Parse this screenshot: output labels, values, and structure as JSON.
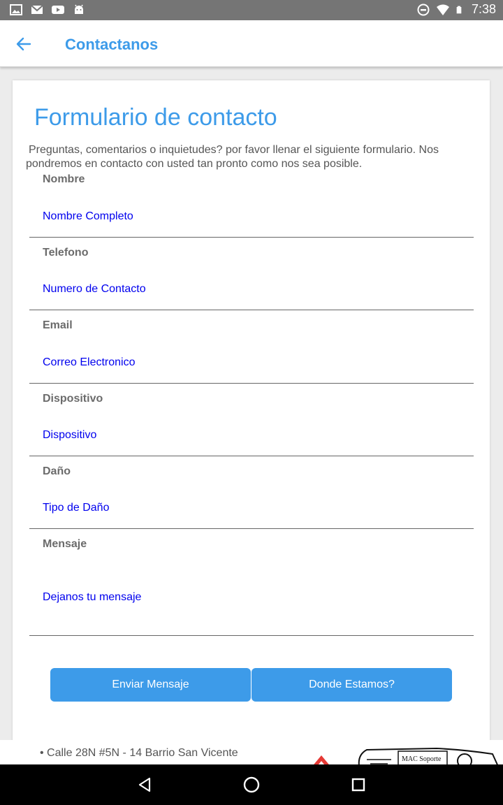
{
  "status_bar": {
    "time": "7:38",
    "left_icons": [
      "image-icon",
      "gmail-icon",
      "youtube-icon",
      "android-icon"
    ],
    "right_icons": [
      "do-not-disturb-icon",
      "wifi-icon",
      "battery-icon"
    ]
  },
  "app_bar": {
    "title": "Contactanos",
    "back_icon": "arrow-back-icon",
    "accent_color": "#3d9be9"
  },
  "form": {
    "title": "Formulario de contacto",
    "description": "Preguntas, comentarios o inquietudes? por favor llenar el siguiente formulario. Nos pondremos en contacto con usted tan pronto como nos sea posible.",
    "fields": [
      {
        "label": "Nombre",
        "placeholder": "Nombre Completo"
      },
      {
        "label": "Telefono",
        "placeholder": "Numero de Contacto"
      },
      {
        "label": "Email",
        "placeholder": "Correo Electronico"
      },
      {
        "label": "Dispositivo",
        "placeholder": "Dispositivo"
      },
      {
        "label": "Daño",
        "placeholder": "Tipo de Daño"
      },
      {
        "label": "Mensaje",
        "placeholder": "Dejanos tu mensaje"
      }
    ],
    "buttons": {
      "send": "Enviar Mensaje",
      "location": "Donde Estamos?"
    }
  },
  "footer": {
    "address": "• Calle 28N #5N - 14 Barrio San Vicente",
    "logo_text": "MAC Soporte"
  },
  "nav_bar": {
    "icons": [
      "back-triangle-icon",
      "home-circle-icon",
      "recents-square-icon"
    ]
  }
}
